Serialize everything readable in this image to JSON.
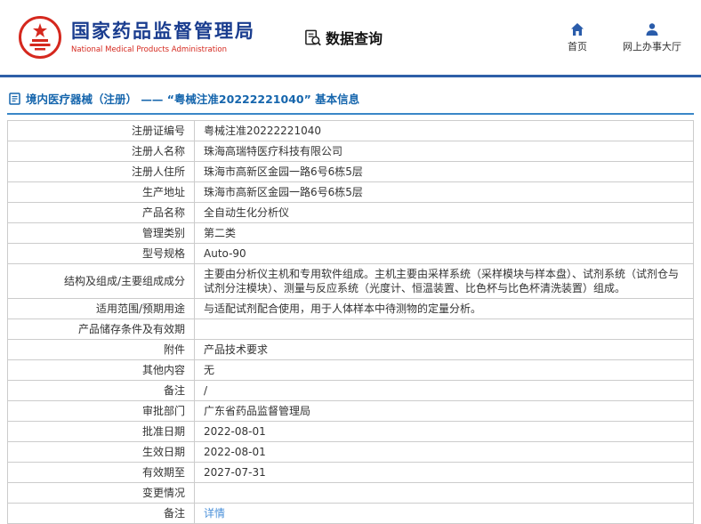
{
  "header": {
    "org_name_cn": "国家药品监督管理局",
    "org_name_en": "National Medical Products Administration",
    "data_query_label": "数据查询",
    "nav_home": "首页",
    "nav_hall": "网上办事大厅"
  },
  "page": {
    "title": "境内医疗器械（注册） —— “粤械注准20222221040” 基本信息"
  },
  "colors": {
    "brand_blue": "#1a3d8f",
    "brand_red": "#d5281e",
    "divider_blue": "#2e5fa8",
    "title_blue": "#1666ad",
    "link_blue": "#4a90d9",
    "table_border": "#cccccc"
  },
  "info_table": {
    "rows": [
      {
        "label": "注册证编号",
        "value": "粤械注准20222221040"
      },
      {
        "label": "注册人名称",
        "value": "珠海高瑞特医疗科技有限公司"
      },
      {
        "label": "注册人住所",
        "value": "珠海市高新区金园一路6号6栋5层"
      },
      {
        "label": "生产地址",
        "value": "珠海市高新区金园一路6号6栋5层"
      },
      {
        "label": "产品名称",
        "value": "全自动生化分析仪"
      },
      {
        "label": "管理类别",
        "value": "第二类"
      },
      {
        "label": "型号规格",
        "value": "Auto-90"
      },
      {
        "label": "结构及组成/主要组成成分",
        "value": "主要由分析仪主机和专用软件组成。主机主要由采样系统（采样模块与样本盘）、试剂系统（试剂仓与试剂分注模块）、测量与反应系统（光度计、恒温装置、比色杯与比色杯清洗装置）组成。"
      },
      {
        "label": "适用范围/预期用途",
        "value": "与适配试剂配合使用，用于人体样本中待测物的定量分析。"
      },
      {
        "label": "产品储存条件及有效期",
        "value": ""
      },
      {
        "label": "附件",
        "value": "产品技术要求"
      },
      {
        "label": "其他内容",
        "value": "无"
      },
      {
        "label": "备注",
        "value": "/"
      },
      {
        "label": "审批部门",
        "value": "广东省药品监督管理局"
      },
      {
        "label": "批准日期",
        "value": "2022-08-01"
      },
      {
        "label": "生效日期",
        "value": "2022-08-01"
      },
      {
        "label": "有效期至",
        "value": "2027-07-31"
      },
      {
        "label": "变更情况",
        "value": ""
      },
      {
        "label": "备注",
        "value": "详情",
        "is_link": true
      }
    ]
  }
}
